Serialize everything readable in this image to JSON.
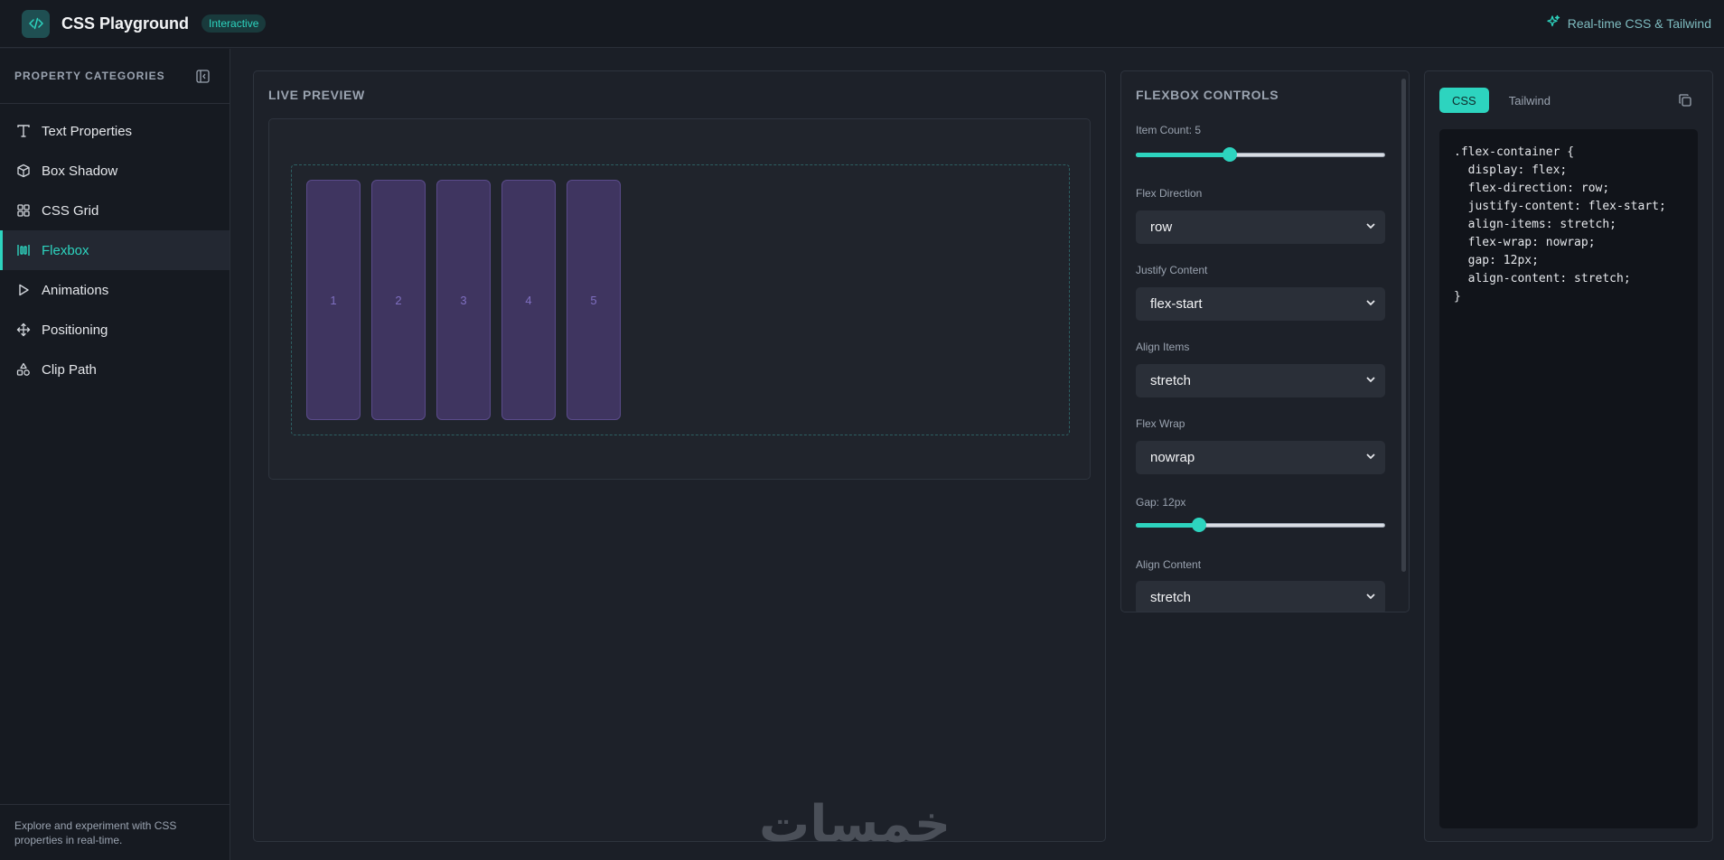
{
  "header": {
    "title": "CSS Playground",
    "badge": "Interactive",
    "right_text": "Real-time CSS & Tailwind",
    "accent": "#2dd4bf"
  },
  "sidebar": {
    "title": "PROPERTY CATEGORIES",
    "items": [
      {
        "label": "Text Properties",
        "icon": "text-icon",
        "active": false
      },
      {
        "label": "Box Shadow",
        "icon": "box-icon",
        "active": false
      },
      {
        "label": "CSS Grid",
        "icon": "grid-icon",
        "active": false
      },
      {
        "label": "Flexbox",
        "icon": "flexbox-icon",
        "active": true
      },
      {
        "label": "Animations",
        "icon": "play-icon",
        "active": false
      },
      {
        "label": "Positioning",
        "icon": "move-icon",
        "active": false
      },
      {
        "label": "Clip Path",
        "icon": "shapes-icon",
        "active": false
      }
    ],
    "footer": "Explore and experiment with CSS properties in real-time."
  },
  "preview": {
    "title": "LIVE PREVIEW",
    "items": [
      "1",
      "2",
      "3",
      "4",
      "5"
    ]
  },
  "controls": {
    "title": "FLEXBOX CONTROLS",
    "item_count_label": "Item Count: 5",
    "item_count_fraction": 0.37,
    "flex_direction_label": "Flex Direction",
    "flex_direction_value": "row",
    "justify_label": "Justify Content",
    "justify_value": "flex-start",
    "align_items_label": "Align Items",
    "align_items_value": "stretch",
    "wrap_label": "Flex Wrap",
    "wrap_value": "nowrap",
    "gap_label": "Gap: 12px",
    "gap_fraction": 0.24,
    "align_content_label": "Align Content",
    "align_content_value": "stretch"
  },
  "code": {
    "tabs": [
      "CSS",
      "Tailwind"
    ],
    "active_tab": "CSS",
    "lines": [
      ".flex-container {",
      "  display: flex;",
      "  flex-direction: row;",
      "  justify-content: flex-start;",
      "  align-items: stretch;",
      "  flex-wrap: nowrap;",
      "  gap: 12px;",
      "  align-content: stretch;",
      "}"
    ]
  },
  "watermark": "خمسات"
}
